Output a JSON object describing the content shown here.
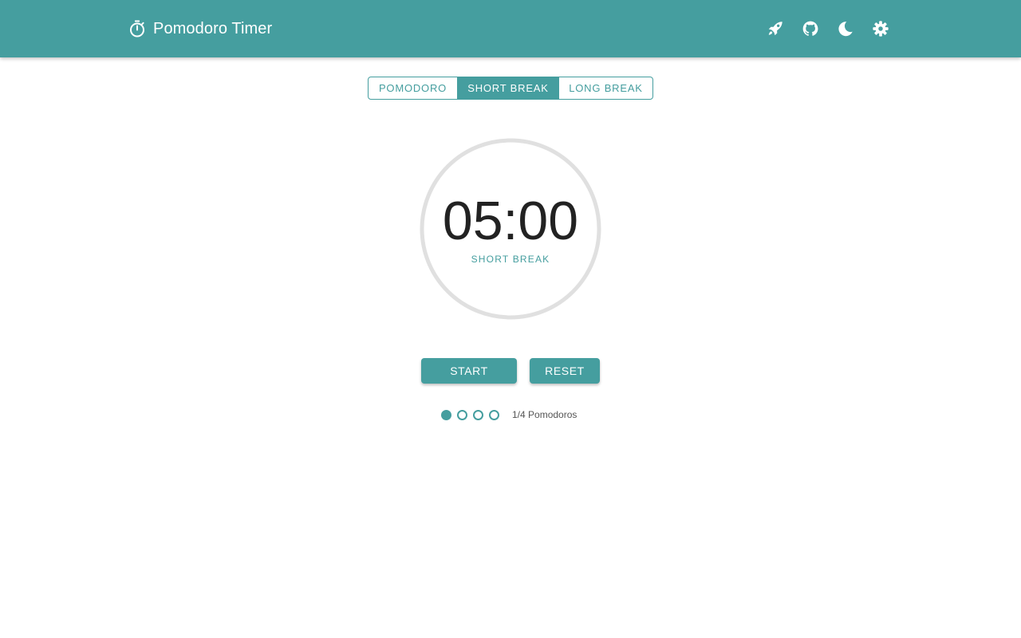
{
  "header": {
    "title": "Pomodoro Timer",
    "logo_icon": "timer-icon",
    "actions": [
      {
        "icon": "rocket-icon"
      },
      {
        "icon": "github-icon"
      },
      {
        "icon": "moon-icon"
      },
      {
        "icon": "gear-icon"
      }
    ],
    "bar_color": "#459e9f"
  },
  "mode_tabs": {
    "items": [
      {
        "label": "POMODORO",
        "selected": false
      },
      {
        "label": "SHORT BREAK",
        "selected": true
      },
      {
        "label": "LONG BREAK",
        "selected": false
      }
    ]
  },
  "timer": {
    "time": "05:00",
    "mode_label": "SHORT BREAK",
    "elapsed_fraction": 0,
    "track_color": "#e0e0e0"
  },
  "controls": {
    "start_label": "START",
    "reset_label": "RESET"
  },
  "progress": {
    "completed": 1,
    "total": 4,
    "label": "1/4 Pomodoros"
  },
  "colors": {
    "accent": "#459e9f",
    "text_dark": "#222222",
    "text_muted": "#555555"
  }
}
